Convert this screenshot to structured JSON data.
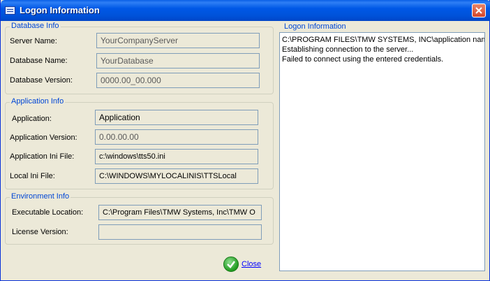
{
  "window": {
    "title": "Logon Information"
  },
  "database_info": {
    "title": "Database Info",
    "server_label": "Server Name:",
    "server_value": "YourCompanyServer",
    "db_name_label": "Database Name:",
    "db_name_value": "YourDatabase",
    "db_version_label": "Database Version:",
    "db_version_value": "0000.00_00.000"
  },
  "application_info": {
    "title": "Application Info",
    "app_label": "Application:",
    "app_value": "Application",
    "app_version_label": "Application Version:",
    "app_version_value": "0.00.00.00",
    "ini_label": "Application Ini File:",
    "ini_value": "c:\\windows\\tts50.ini",
    "local_ini_label": "Local Ini File:",
    "local_ini_value": "C:\\WINDOWS\\MYLOCALINIS\\TTSLocal"
  },
  "environment_info": {
    "title": "Environment Info",
    "exe_label": "Executable Location:",
    "exe_value": "C:\\Program Files\\TMW Systems, Inc\\TMW O",
    "license_label": "License Version:",
    "license_value": ""
  },
  "log": {
    "title": "Logon Information",
    "lines": [
      "C:\\PROGRAM FILES\\TMW SYSTEMS, INC\\application nam",
      "Establishing connection to the server...",
      "Failed to connect using the entered credentials."
    ]
  },
  "footer": {
    "close_label": "Close"
  }
}
